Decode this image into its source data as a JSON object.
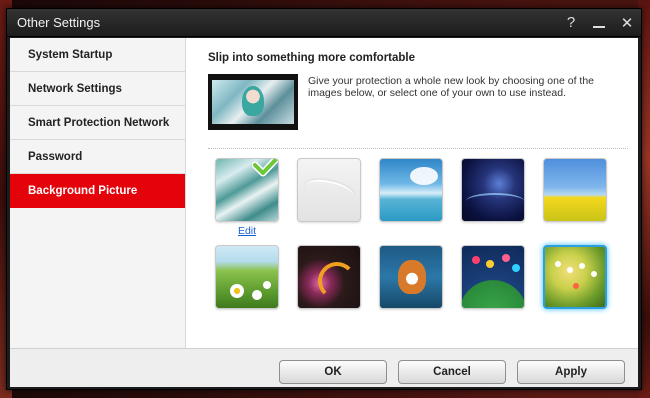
{
  "window": {
    "title": "Other Settings",
    "help_glyph": "?",
    "close_glyph": "✕"
  },
  "sidebar": {
    "items": [
      {
        "label": "System Startup",
        "active": false
      },
      {
        "label": "Network Settings",
        "active": false
      },
      {
        "label": "Smart Protection Network",
        "active": false
      },
      {
        "label": "Password",
        "active": false
      },
      {
        "label": "Background Picture",
        "active": true
      }
    ]
  },
  "main": {
    "heading": "Slip into something more comfortable",
    "description": "Give your protection a whole new look by choosing one of the images below, or select one of your own to use instead.",
    "edit_label": "Edit",
    "thumbnails": [
      {
        "name": "anime-girl",
        "current": true
      },
      {
        "name": "white-abstract",
        "current": false
      },
      {
        "name": "sky-ocean",
        "current": false
      },
      {
        "name": "night-aurora",
        "current": false
      },
      {
        "name": "flower-field",
        "current": false
      },
      {
        "name": "daisy-meadow",
        "current": false
      },
      {
        "name": "floral-swirl",
        "current": false
      },
      {
        "name": "cartoon-dog",
        "current": false
      },
      {
        "name": "cartoon-hill",
        "current": false
      },
      {
        "name": "cartoon-meadow",
        "current": false,
        "highlighted": true
      }
    ]
  },
  "footer": {
    "ok_label": "OK",
    "cancel_label": "Cancel",
    "apply_label": "Apply"
  },
  "colors": {
    "accent": "#e4030b",
    "link": "#1a5fd0",
    "selection_glow": "#36b6ff",
    "checkmark": "#6cc83a"
  }
}
